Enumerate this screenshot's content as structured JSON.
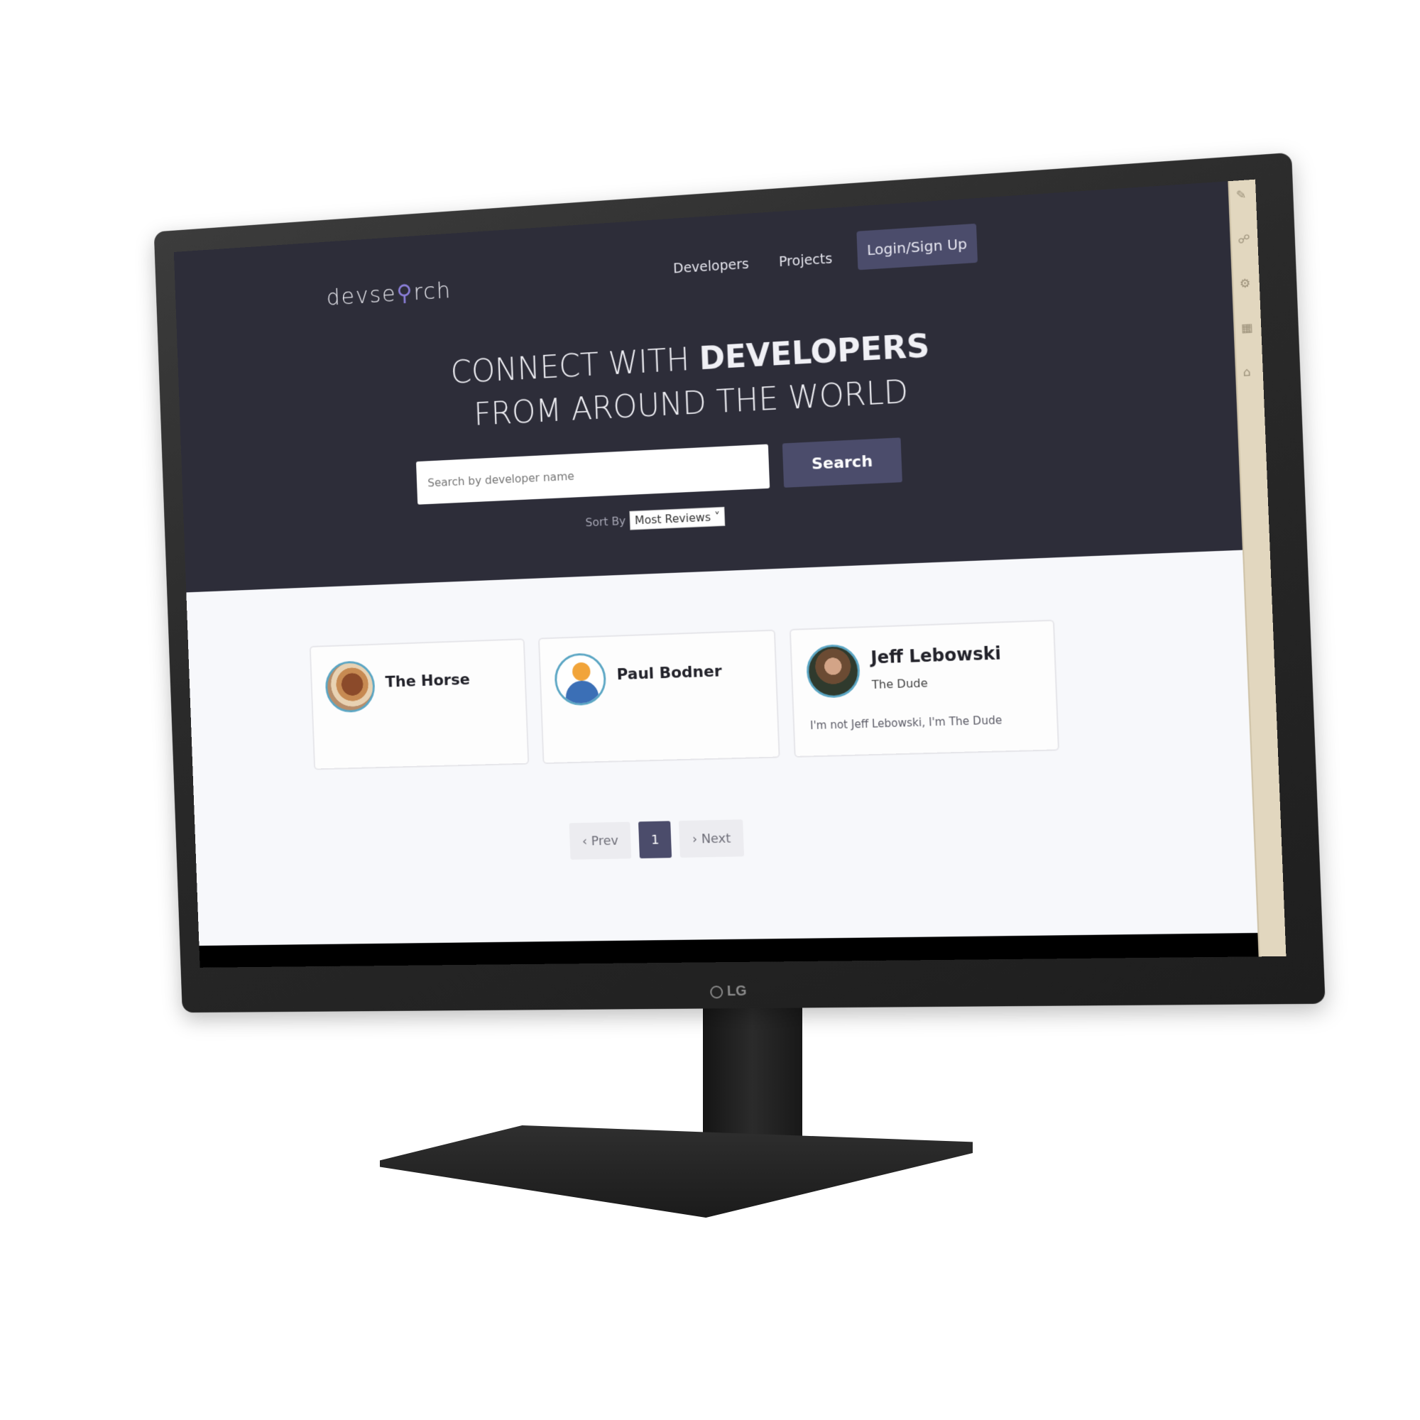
{
  "monitor": {
    "brand": "LG"
  },
  "nav": {
    "logo_text_start": "devse",
    "logo_text_end": "rch",
    "links": [
      "Developers",
      "Projects"
    ],
    "login_label": "Login/Sign Up"
  },
  "hero": {
    "headline_line1_normal": "CONNECT WITH",
    "headline_line1_bold": "DEVELOPERS",
    "headline_line2": "FROM AROUND THE WORLD",
    "search_placeholder": "Search by developer name",
    "search_button": "Search",
    "sort_label": "Sort By",
    "sort_value": "Most Reviews"
  },
  "developers": [
    {
      "name": "The Horse",
      "role": "",
      "bio": ""
    },
    {
      "name": "Paul Bodner",
      "role": "",
      "bio": ""
    },
    {
      "name": "Jeff Lebowski",
      "role": "The Dude",
      "bio": "I'm not Jeff Lebowski, I'm The Dude"
    }
  ],
  "pagination": {
    "prev_label": "Prev",
    "current_page": "1",
    "next_label": "Next"
  },
  "colors": {
    "hero_bg": "#2d2d39",
    "accent": "#4b4c6b",
    "page_bg": "#f7f8fb"
  }
}
